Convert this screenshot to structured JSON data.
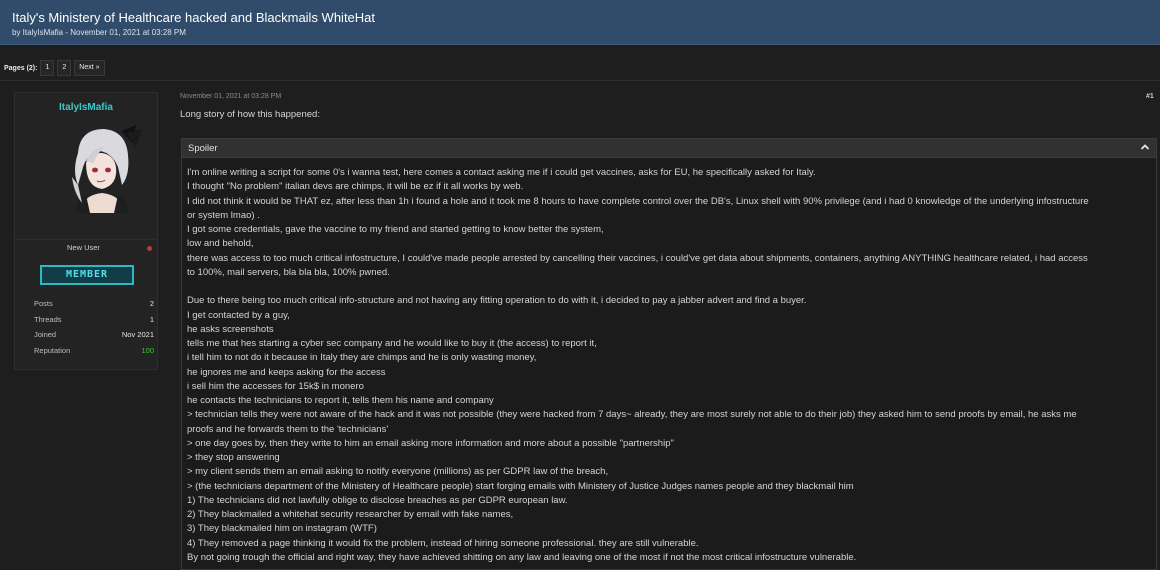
{
  "thread": {
    "title": "Italy's Ministery of Healthcare hacked and Blackmails WhiteHat",
    "meta": "by ItalyIsMafia - November 01, 2021 at 03:28 PM"
  },
  "pagination": {
    "label": "Pages (2):",
    "pages": [
      "1",
      "2"
    ],
    "next": "Next »"
  },
  "user": {
    "name": "ItalyIsMafia",
    "role": "New User",
    "badge": "MEMBER",
    "stats": [
      {
        "label": "Posts",
        "value": "2"
      },
      {
        "label": "Threads",
        "value": "1"
      },
      {
        "label": "Joined",
        "value": "Nov 2021"
      },
      {
        "label": "Reputation",
        "value": "100"
      }
    ],
    "colors": {
      "name": "#33cccc",
      "badge": "#2cb9c4",
      "reputation": "#2fcf2f",
      "offline": "#b83a3a"
    }
  },
  "post": {
    "date": "November 01, 2021 at 03:28 PM",
    "number": "#1",
    "intro": "Long story of how this happened:",
    "spoiler_title": "Spoiler",
    "lines": [
      "I'm online writing a script for some 0's i wanna test, here comes a contact asking me if i could get vaccines, asks for EU, he specifically asked for Italy.",
      "I thought \"No problem\" italian devs are chimps, it will be ez if it all works by web.",
      "I did not think it would be THAT ez, after less than 1h i found a hole and it took me 8 hours to have complete control over the DB's, Linux shell with 90% privilege (and i had 0 knowledge of the underlying infostructure",
      "or system lmao) .",
      "I got some credentials, gave the vaccine to my friend and started getting to know better the system,",
      "low and behold,",
      "there was access to too much critical infostructure, I could've made people arrested by cancelling their vaccines, i could've get data about shipments, containers, anything ANYTHING healthcare related, i had access",
      "to 100%, mail servers, bla bla bla, 100% pwned.",
      "",
      "Due to there being too much critical info-structure and not having any fitting operation to do with it, i decided to pay a jabber advert and find a buyer.",
      "I get contacted by a guy,",
      "he asks screenshots",
      "tells me that hes starting a cyber sec company and he would like to buy it (the access) to report it,",
      "i tell him to not do it because in Italy they are chimps and he is only wasting money,",
      "he ignores me and keeps asking for the access",
      "i sell him the accesses for 15k$ in monero",
      "he contacts the technicians to report it, tells them his name and company",
      "> technician tells they were not aware of the hack and it was not possible (they were hacked from 7 days~ already, they are most surely not able to do their job) they asked him to send proofs by email, he asks me",
      "proofs and he forwards them to the 'technicians'",
      "> one day goes by, then they write to him an email asking more information and more about a possible \"partnership\"",
      "> they stop answering",
      "> my client sends them an email asking to notify everyone (millions) as per GDPR law of the breach,",
      "> (the technicians department of the Ministery of Healthcare people) start forging emails with Ministery of Justice Judges names people and they blackmail him",
      "1) The technicians did not lawfully oblige to disclose breaches as per GDPR european law.",
      "2) They blackmailed a whitehat security researcher by email with fake names,",
      "3) They blackmailed him on instagram (WTF)",
      "4) They removed a page thinking it would fix the problem, instead of hiring someone professional. they are still vulnerable.",
      "By not going trough the official and right way, they have achieved shitting on any law and leaving one of the most if not the most critical infostructure vulnerable."
    ]
  }
}
